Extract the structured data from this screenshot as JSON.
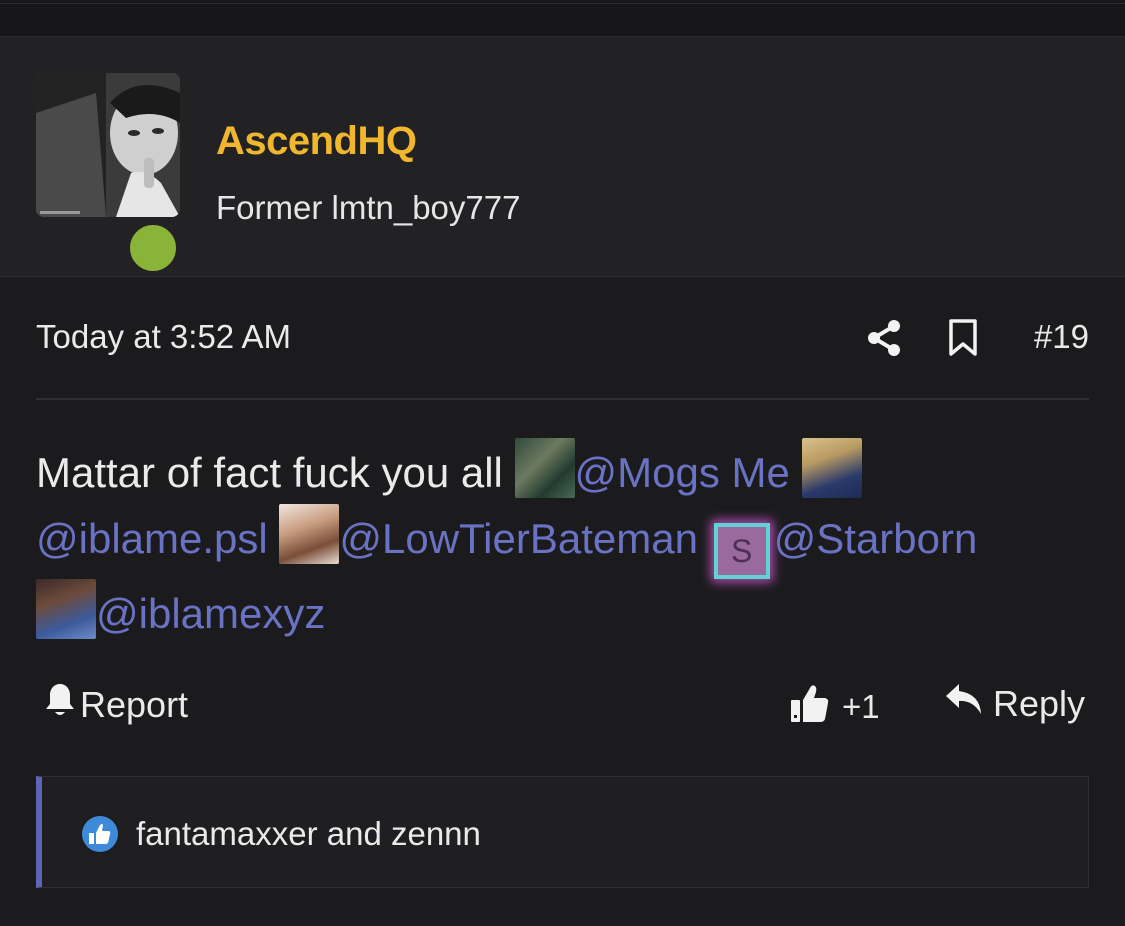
{
  "user": {
    "name": "AscendHQ",
    "title": "Former lmtn_boy777",
    "online_color": "#8ab33a",
    "name_color": "#f0b62e"
  },
  "post": {
    "date": "Today at 3:52 AM",
    "number": "#19",
    "body_intro": "Mattar of fact fuck you all",
    "mentions": [
      "@Mogs Me",
      "@iblame.psl",
      "@LowTierBateman",
      "@Starborn",
      "@iblamexyz"
    ],
    "starborn_avatar_letter": "S",
    "mention_color": "#6a72c4"
  },
  "actions": {
    "report_label": "Report",
    "like_label": "+1",
    "reply_label": "Reply"
  },
  "reactions": {
    "text": "fantamaxxer and zennn",
    "accent_color": "#5d64b8"
  },
  "icons": [
    "share-icon",
    "bookmark-icon",
    "bell-icon",
    "thumbs-up-icon",
    "reply-arrow-icon",
    "like-badge-icon"
  ]
}
